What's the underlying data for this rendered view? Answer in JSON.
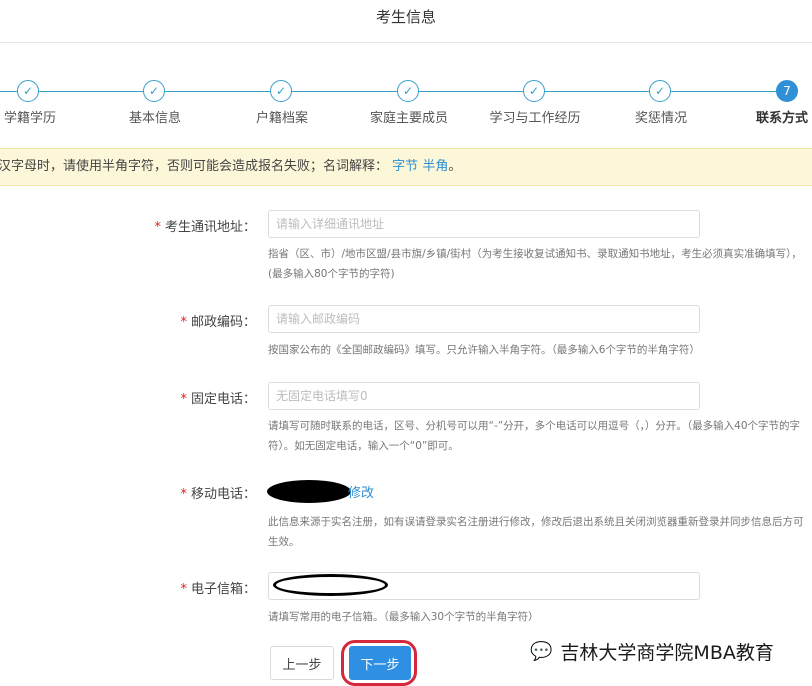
{
  "header": {
    "title": "考生信息"
  },
  "steps": [
    {
      "label": "学籍学历",
      "mark": "✓",
      "active": false
    },
    {
      "label": "基本信息",
      "mark": "✓",
      "active": false
    },
    {
      "label": "户籍档案",
      "mark": "✓",
      "active": false
    },
    {
      "label": "家庭主要成员",
      "mark": "✓",
      "active": false
    },
    {
      "label": "学习与工作经历",
      "mark": "✓",
      "active": false
    },
    {
      "label": "奖惩情况",
      "mark": "✓",
      "active": false
    },
    {
      "label": "联系方式",
      "mark": "7",
      "active": true
    }
  ],
  "notice": {
    "text": "汉字母时，请使用半角字符，否则可能会造成报名失败；名词解释：",
    "link_bytes": "字节",
    "link_halfwidth": "半角",
    "end": "。"
  },
  "form": {
    "address": {
      "required_mark": "*",
      "label": "考生通讯地址：",
      "placeholder": "请输入详细通讯地址",
      "help_line1": "指省（区、市）/地市区盟/县市旗/乡镇/街村（为考生接收复试通知书、录取通知书地址，考生必须真实准确填写），",
      "help_line2": "(最多输入80个字节的字符)"
    },
    "postcode": {
      "required_mark": "*",
      "label": "邮政编码：",
      "placeholder": "请输入邮政编码",
      "help": "按国家公布的《全国邮政编码》填写。只允许输入半角字符。（最多输入6个字节的半角字符）"
    },
    "landline": {
      "required_mark": "*",
      "label": "固定电话：",
      "placeholder": "无固定电话填写0",
      "help_line1": "请填写可随时联系的电话，区号、分机号可以用“-”分开，多个电话可以用逗号（，）分开。（最多输入40个字节的字",
      "help_line2": "符）。如无固定电话，输入一个“0”即可。"
    },
    "mobile": {
      "required_mark": "*",
      "label": "移动电话：",
      "modify_link": "修改",
      "help_line1": "此信息来源于实名注册，如有误请登录实名注册进行修改，修改后退出系统且关闭浏览器重新登录并同步信息后方可",
      "help_line2": "生效。"
    },
    "email": {
      "required_mark": "*",
      "label": "电子信箱：",
      "help": "请填写常用的电子信箱。（最多输入30个字节的半角字符）"
    }
  },
  "buttons": {
    "prev": "上一步",
    "next": "下一步"
  },
  "watermark": {
    "icon": "💬",
    "text": "吉林大学商学院MBA教育"
  },
  "colors": {
    "accent": "#2f90e3",
    "step": "#37a0c9",
    "required": "#e02020",
    "notice_bg": "#fdf7d9"
  }
}
